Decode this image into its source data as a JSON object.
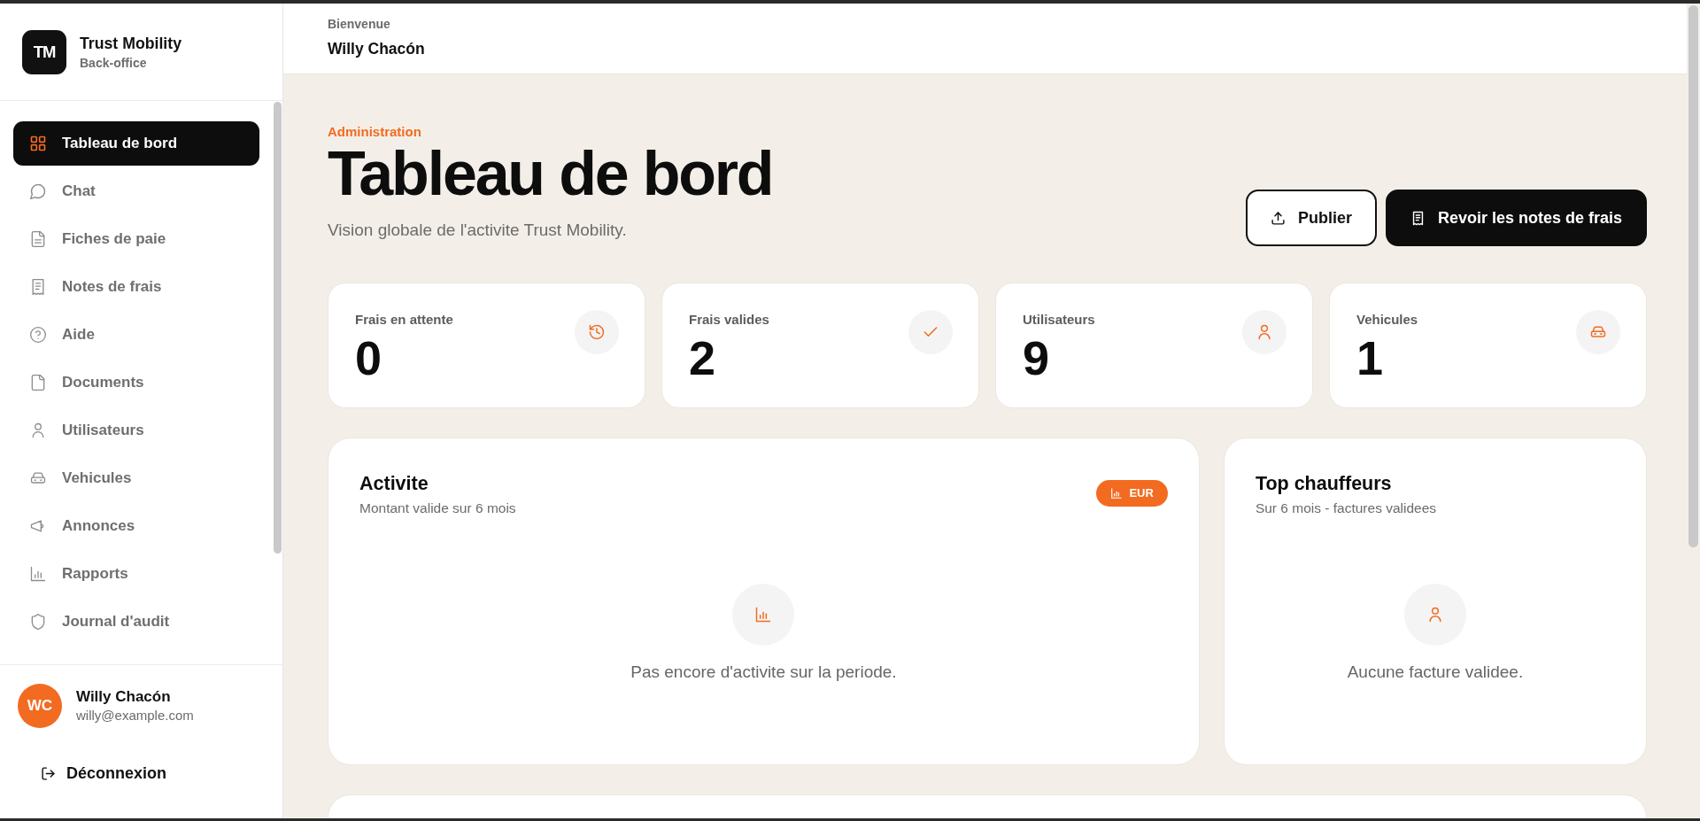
{
  "brand": {
    "logo": "TM",
    "name": "Trust Mobility",
    "subtitle": "Back-office"
  },
  "sidebar": {
    "items": [
      {
        "label": "Tableau de bord",
        "selected": true
      },
      {
        "label": "Chat",
        "selected": false
      },
      {
        "label": "Fiches de paie",
        "selected": false
      },
      {
        "label": "Notes de frais",
        "selected": false
      },
      {
        "label": "Aide",
        "selected": false
      },
      {
        "label": "Documents",
        "selected": false
      },
      {
        "label": "Utilisateurs",
        "selected": false
      },
      {
        "label": "Vehicules",
        "selected": false
      },
      {
        "label": "Annonces",
        "selected": false
      },
      {
        "label": "Rapports",
        "selected": false
      },
      {
        "label": "Journal d'audit",
        "selected": false
      }
    ]
  },
  "user": {
    "initials": "WC",
    "name": "Willy Chacón",
    "email": "willy@example.com"
  },
  "logout": {
    "label": "Déconnexion"
  },
  "header": {
    "greeting": "Bienvenue",
    "name": "Willy Chacón"
  },
  "page": {
    "eyebrow": "Administration",
    "title": "Tableau de bord",
    "subtitle": "Vision globale de l'activite Trust Mobility."
  },
  "actions": [
    {
      "label": "Publier",
      "kind": "outline"
    },
    {
      "label": "Revoir les notes de frais",
      "kind": "primary"
    }
  ],
  "stats": [
    {
      "label": "Frais en attente",
      "value": "0"
    },
    {
      "label": "Frais valides",
      "value": "2"
    },
    {
      "label": "Utilisateurs",
      "value": "9"
    },
    {
      "label": "Vehicules",
      "value": "1"
    }
  ],
  "panels": [
    {
      "title": "Activite",
      "subtitle": "Montant valide sur 6 mois",
      "badge": "EUR",
      "empty_message": "Pas encore d'activite sur la periode."
    },
    {
      "title": "Top chauffeurs",
      "subtitle": "Sur 6 mois - factures validees",
      "empty_message": "Aucune facture validee."
    }
  ]
}
